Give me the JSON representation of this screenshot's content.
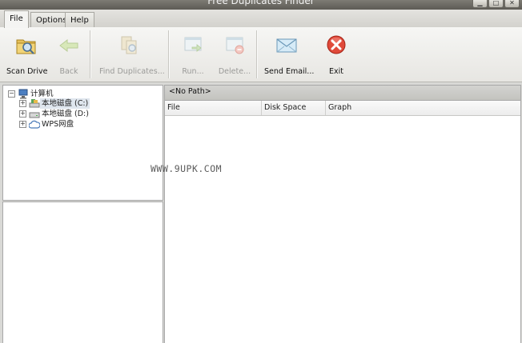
{
  "window": {
    "title": "Free Duplicates Finder"
  },
  "tabs": [
    {
      "label": "File",
      "active": true
    },
    {
      "label": "Options",
      "active": false
    },
    {
      "label": "Help",
      "active": false
    }
  ],
  "toolbar": {
    "scan_drive": "Scan Drive",
    "back": "Back",
    "find_duplicates": "Find Duplicates...",
    "run": "Run...",
    "delete": "Delete...",
    "send_email": "Send Email...",
    "exit": "Exit"
  },
  "tree": {
    "root": "计算机",
    "children": [
      "本地磁盘 (C:)",
      "本地磁盘 (D:)",
      "WPS网盘"
    ]
  },
  "results": {
    "path": "<No Path>",
    "columns": [
      "File",
      "Disk Space",
      "Graph"
    ]
  },
  "watermark": "WWW.9UPK.COM",
  "icons": {
    "scan": "folder-search-icon",
    "back": "back-arrow-icon",
    "find": "find-duplicates-icon",
    "run": "run-icon",
    "delete": "delete-icon",
    "email": "envelope-icon",
    "exit": "exit-icon"
  }
}
